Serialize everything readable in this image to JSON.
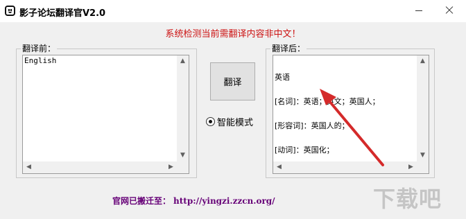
{
  "window": {
    "title": "影子论坛翻译官V2.0",
    "minimize_icon": "minimize-icon",
    "close_icon": "close-icon"
  },
  "status_message": "系统检测当前需翻译内容非中文！",
  "source_panel": {
    "label": "翻译前：",
    "text": "English"
  },
  "result_panel": {
    "label": "翻译后：",
    "lines": [
      "英语",
      "[名词]：英语；英文；英国人；",
      "[形容词]：英国人的；",
      "[动词]：英国化；"
    ]
  },
  "translate_button": {
    "label": "翻译"
  },
  "mode": {
    "label": "智能模式",
    "selected": true
  },
  "footer": {
    "text": "官网已搬迁至：",
    "url": "http://yingzi.zzcn.org/"
  },
  "watermark": {
    "text": "下载吧"
  },
  "colors": {
    "status": "#cc1111",
    "footer": "#660077",
    "annotation_arrow": "#d42a2a"
  }
}
